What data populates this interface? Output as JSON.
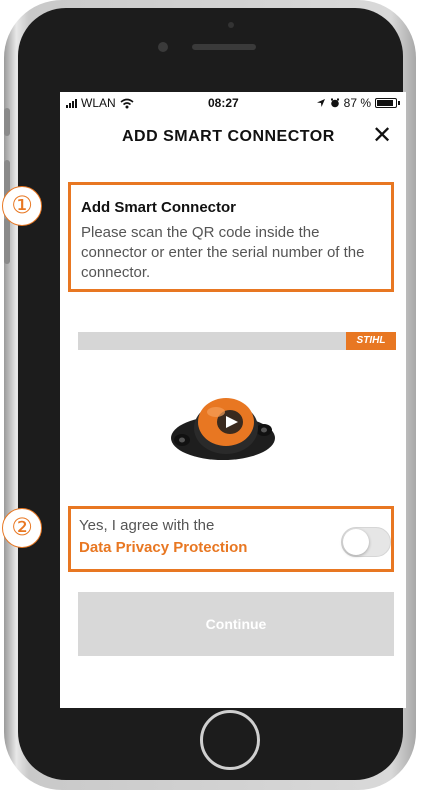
{
  "status_bar": {
    "carrier": "WLAN",
    "time": "08:27",
    "battery": "87 %"
  },
  "header": {
    "title": "ADD SMART CONNECTOR",
    "close_icon": "✕"
  },
  "info": {
    "title": "Add Smart Connector",
    "description": "Please scan the QR code inside the connector or enter the serial number of the connector."
  },
  "brand": {
    "logo_text": "STIHL"
  },
  "privacy": {
    "agree_text": "Yes, I agree with the",
    "link_text": "Data Privacy Protection",
    "toggle_on": false
  },
  "continue_button": {
    "label": "Continue"
  },
  "markers": {
    "one": "①",
    "two": "②"
  },
  "colors": {
    "accent": "#e87722",
    "disabled": "#d8d8d8"
  }
}
